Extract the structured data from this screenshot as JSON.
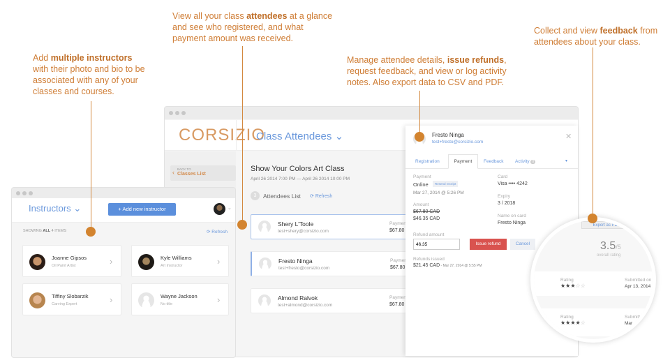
{
  "callouts": [
    {
      "pre": "Add ",
      "bold": "multiple instructors",
      "post": " with their photo and bio to be associated with any of your classes and courses."
    },
    {
      "pre": "View all your class ",
      "bold": "attendees",
      "post": " at a glance and see who registered, and what payment amount was received."
    },
    {
      "pre": "Manage attendee details, ",
      "bold": "issue refunds",
      "post": ", request feedback, and view or log activity notes. Also export data to CSV and PDF."
    },
    {
      "pre": "Collect and view ",
      "bold": "feedback",
      "post": " from attendees about your class."
    }
  ],
  "main_window": {
    "logo": "CORSIZIO",
    "page_title": "Class Attendees",
    "back": {
      "small": "BACK TO",
      "label": "Classes List"
    },
    "class_title": "Show Your Colors Art Class",
    "class_dates": "April 26 2014 7:00 PM — April 26 2014 10:00 PM",
    "attendee_count": "3",
    "attendees_label": "Attendees List",
    "refresh": "Refresh",
    "attendees": [
      {
        "name": "Shery L'Toole",
        "email": "test+shery@corsizio.com",
        "pay_label": "Payment",
        "amount": "$67.80"
      },
      {
        "name": "Fresto Ninga",
        "email": "test+fresto@corsizio.com",
        "pay_label": "Payment",
        "amount": "$67.80"
      },
      {
        "name": "Almond Ralvok",
        "email": "test+almond@corsizio.com",
        "pay_label": "Payment",
        "amount": "$67.80"
      }
    ]
  },
  "detail": {
    "name": "Fresto Ninga",
    "email": "test+fresto@corsizio.com",
    "tabs": [
      "Registration",
      "Payment",
      "Feedback",
      "Activity"
    ],
    "activity_count": "0",
    "payment_label": "Payment",
    "payment_value": "Online",
    "resend": "Resend receipt",
    "payment_date": "Mar 27, 2014 @ 5:26 PM",
    "amount_label": "Amount",
    "amount_old": "$67.80 CAD",
    "amount_new": "$46.35 CAD",
    "card_label": "Card",
    "card_value": "Visa •••• 4242",
    "expiry_label": "Expiry",
    "expiry_value": "3 / 2018",
    "nameoncard_label": "Name on card",
    "nameoncard_value": "Fresto Ninga",
    "refund_label": "Refund amount",
    "refund_value": "46.35",
    "issue_refund": "Issue refund",
    "cancel": "Cancel",
    "refunds_issued_label": "Refunds issued",
    "refunds_issued_value": "$21.45 CAD",
    "refunds_issued_date": " - Mar 27, 2014 @ 5:55 PM"
  },
  "feedback": {
    "export": "Export as PDF",
    "rating": "3.5",
    "out_of": "/5",
    "overall": "overall rating",
    "items": [
      {
        "label": "Rating",
        "stars": 3,
        "submitted_label": "Submitted on",
        "submitted": "Apr 13, 2014"
      },
      {
        "label": "Rating",
        "stars": 4,
        "submitted_label": "Submitted on",
        "submitted": "Mar"
      }
    ]
  },
  "instructors_window": {
    "title": "Instructors",
    "add_button": "+ Add new instructor",
    "showing_pre": "SHOWING ",
    "showing_bold": "ALL",
    "showing_post": " 4 ITEMS",
    "refresh": "Refresh",
    "items": [
      {
        "name": "Joanne Gipsos",
        "title": "Oil Paint Artist"
      },
      {
        "name": "Kyle Williams",
        "title": "Art Instructor"
      },
      {
        "name": "Tiffiny Slobarzik",
        "title": "Carving Expert"
      },
      {
        "name": "Wayne Jackson",
        "title": "No title"
      }
    ]
  },
  "colors": {
    "accent": "#d3842f",
    "link": "#6a98dc",
    "danger": "#d9534f",
    "button": "#5b8fdc"
  }
}
